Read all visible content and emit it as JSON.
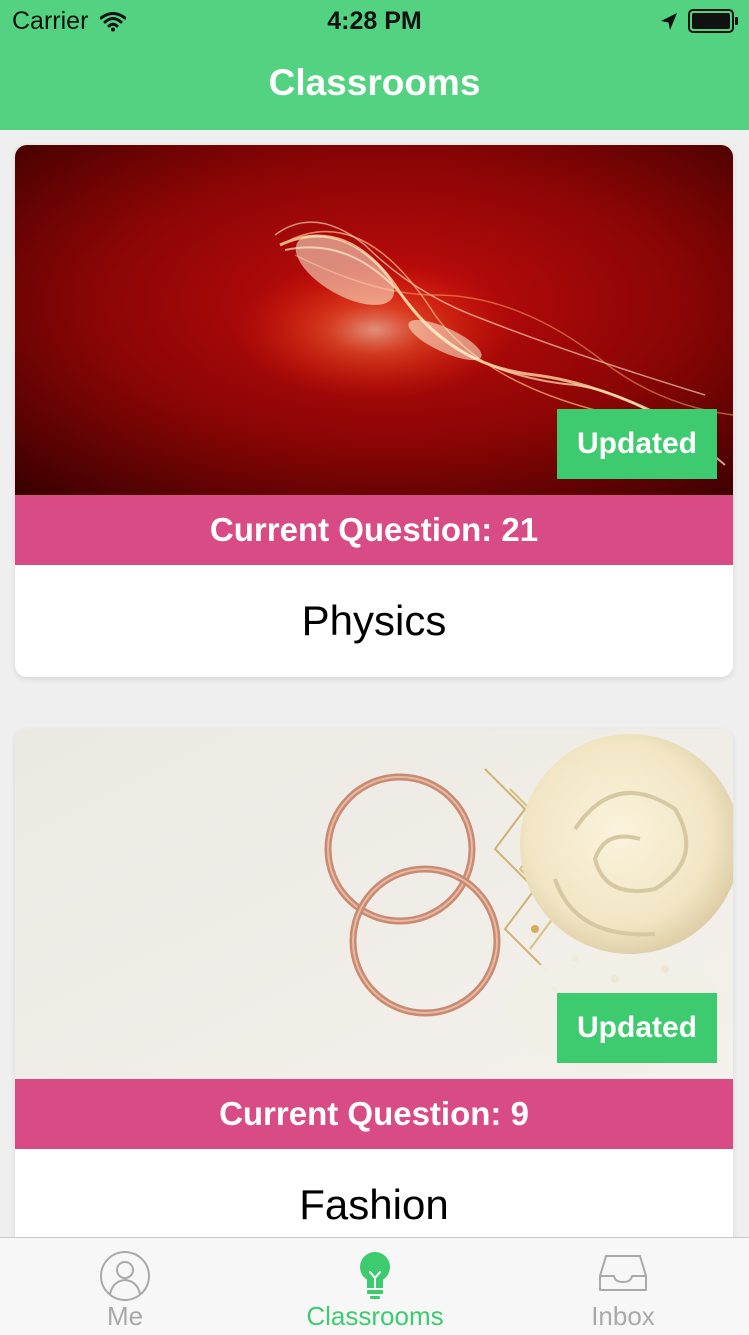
{
  "status_bar": {
    "carrier": "Carrier",
    "time": "4:28 PM"
  },
  "nav": {
    "title": "Classrooms"
  },
  "classrooms": [
    {
      "name": "Physics",
      "badge": "Updated",
      "question_label": "Current Question: 21",
      "image": "red-light-swirl-image"
    },
    {
      "name": "Fashion",
      "badge": "Updated",
      "question_label": "Current Question: 9",
      "image": "rings-and-rose-image"
    }
  ],
  "tabs": [
    {
      "label": "Me",
      "icon": "person-icon",
      "selected": false
    },
    {
      "label": "Classrooms",
      "icon": "lightbulb-icon",
      "selected": true
    },
    {
      "label": "Inbox",
      "icon": "inbox-tray-icon",
      "selected": false
    }
  ],
  "colors": {
    "nav_green": "#53d381",
    "badge_green": "#3ecb6f",
    "question_pink": "#d84b84",
    "tab_inactive": "#a9a9a9"
  }
}
